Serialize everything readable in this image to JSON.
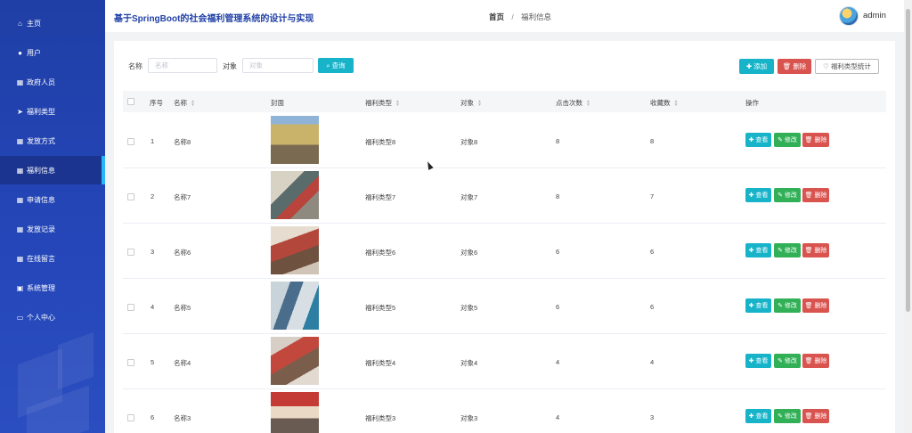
{
  "header": {
    "system_title": "基于SpringBoot的社会福利管理系统的设计与实现",
    "breadcrumb_home": "首页",
    "breadcrumb_separator": "/",
    "breadcrumb_current": "福利信息",
    "username": "admin"
  },
  "sidebar": {
    "items": [
      {
        "label": "主页",
        "icon": "home-icon",
        "glyph": "⌂"
      },
      {
        "label": "用户",
        "icon": "location-pin-icon",
        "glyph": "●"
      },
      {
        "label": "政府人员",
        "icon": "grid-icon",
        "glyph": "▦"
      },
      {
        "label": "福利类型",
        "icon": "paper-plane-icon",
        "glyph": "➤"
      },
      {
        "label": "发放方式",
        "icon": "grid-icon",
        "glyph": "▦"
      },
      {
        "label": "福利信息",
        "icon": "grid-icon",
        "glyph": "▦",
        "active": true
      },
      {
        "label": "申请信息",
        "icon": "grid-icon",
        "glyph": "▦"
      },
      {
        "label": "发放记录",
        "icon": "grid-icon",
        "glyph": "▦"
      },
      {
        "label": "在线留言",
        "icon": "grid-icon",
        "glyph": "▦"
      },
      {
        "label": "系统管理",
        "icon": "clipboard-icon",
        "glyph": "▣"
      },
      {
        "label": "个人中心",
        "icon": "id-card-icon",
        "glyph": "▭"
      }
    ]
  },
  "search": {
    "name_label": "名称",
    "name_placeholder": "名称",
    "target_label": "对象",
    "target_placeholder": "对象",
    "query_label": "查询"
  },
  "toolbar": {
    "add_label": "添加",
    "delete_label": "删除",
    "stats_label": "福利类型统计"
  },
  "table": {
    "columns": [
      "序号",
      "名称",
      "封面",
      "福利类型",
      "对象",
      "点击次数",
      "收藏数",
      "操作"
    ],
    "actions": {
      "view": "查看",
      "edit": "修改",
      "delete": "删除"
    },
    "rows": [
      {
        "index": "1",
        "name": "名称8",
        "type": "福利类型8",
        "target": "对象8",
        "clicks": "8",
        "favorites": "8"
      },
      {
        "index": "2",
        "name": "名称7",
        "type": "福利类型7",
        "target": "对象7",
        "clicks": "8",
        "favorites": "7"
      },
      {
        "index": "3",
        "name": "名称6",
        "type": "福利类型6",
        "target": "对象6",
        "clicks": "6",
        "favorites": "6"
      },
      {
        "index": "4",
        "name": "名称5",
        "type": "福利类型5",
        "target": "对象5",
        "clicks": "6",
        "favorites": "6"
      },
      {
        "index": "5",
        "name": "名称4",
        "type": "福利类型4",
        "target": "对象4",
        "clicks": "4",
        "favorites": "4"
      },
      {
        "index": "6",
        "name": "名称3",
        "type": "福利类型3",
        "target": "对象3",
        "clicks": "4",
        "favorites": "3"
      }
    ]
  },
  "colors": {
    "sidebar_bg": "#2446b8",
    "accent_cyan": "#17b3c9",
    "danger_red": "#d9534f",
    "success_green": "#31b057",
    "title_blue": "#1f3fa6"
  }
}
